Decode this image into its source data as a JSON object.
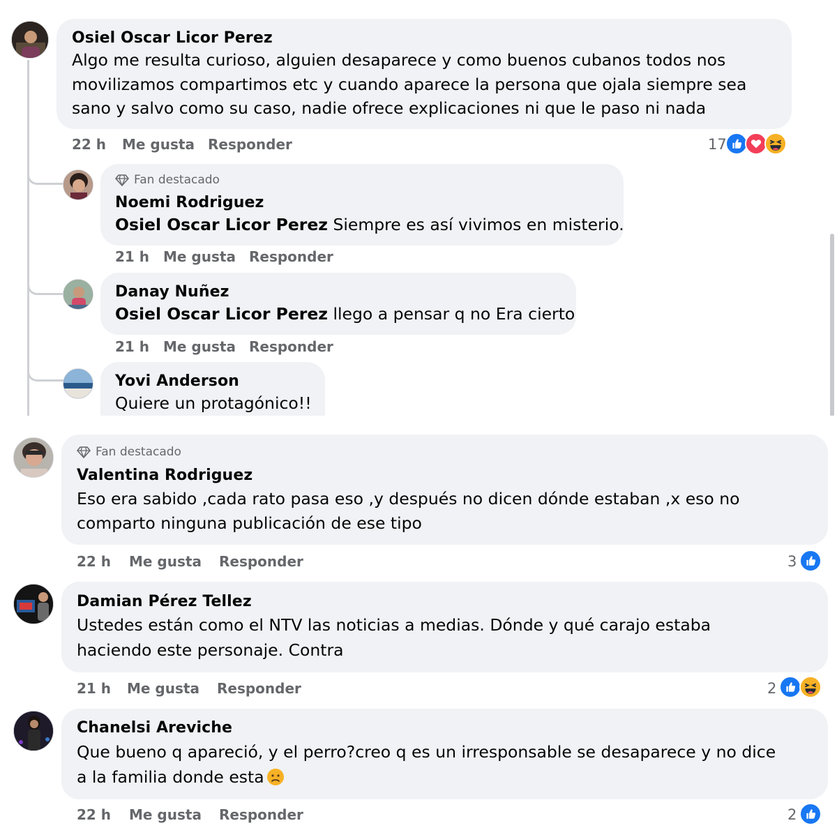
{
  "colors": {
    "bubble": "#f0f2f5",
    "meta": "#65676b",
    "like": "#1877f2",
    "love": "#f33e58",
    "haha": "#f7b125"
  },
  "top_thread": {
    "comment": {
      "author": "Osiel Oscar Licor Perez",
      "lines": [
        "Algo me resulta curioso, alguien desaparece y como buenos cubanos todos nos",
        "movilizamos compartimos etc y cuando aparece la persona que ojala siempre sea",
        "sano y salvo como su caso, nadie ofrece explicaciones ni que le paso ni nada"
      ],
      "time": "22 h",
      "like": "Me gusta",
      "reply": "Responder",
      "reaction_count": "17",
      "reactions": [
        "like-icon",
        "love-icon",
        "haha-icon"
      ]
    },
    "replies": [
      {
        "badge": "Fan destacado",
        "author": "Noemi Rodriguez",
        "mention": "Osiel Oscar Licor Perez",
        "text": " Siempre es así vivimos en misterio.",
        "time": "21 h",
        "like": "Me gusta",
        "reply": "Responder"
      },
      {
        "author": "Danay Nuñez",
        "mention": "Osiel Oscar Licor Perez",
        "text": " llego a pensar q no Era cierto",
        "time": "21 h",
        "like": "Me gusta",
        "reply": "Responder"
      },
      {
        "author": "Yovi Anderson",
        "text": "Quiere un protagónico!!"
      }
    ]
  },
  "comments": [
    {
      "badge": "Fan destacado",
      "author": "Valentina Rodriguez",
      "lines": [
        "Eso era sabido ,cada rato pasa eso ,y después no dicen dónde estaban ,x eso no",
        "comparto ninguna publicación de ese tipo"
      ],
      "time": "22 h",
      "like": "Me gusta",
      "reply": "Responder",
      "reaction_count": "3",
      "reactions": [
        "like-icon"
      ]
    },
    {
      "author": "Damian Pérez Tellez",
      "lines": [
        "Ustedes están como el NTV las noticias a medias. Dónde y qué carajo estaba",
        "haciendo este personaje. Contra"
      ],
      "time": "21 h",
      "like": "Me gusta",
      "reply": "Responder",
      "reaction_count": "2",
      "reactions": [
        "like-icon",
        "haha-icon"
      ]
    },
    {
      "author": "Chanelsi Areviche",
      "lines": [
        "Que bueno q apareció, y el perro?creo q es un irresponsable se desaparece y no dice",
        "a la familia donde esta"
      ],
      "emoji": "sad-face-icon",
      "time": "22 h",
      "like": "Me gusta",
      "reply": "Responder",
      "reaction_count": "2",
      "reactions": [
        "like-icon"
      ]
    }
  ]
}
